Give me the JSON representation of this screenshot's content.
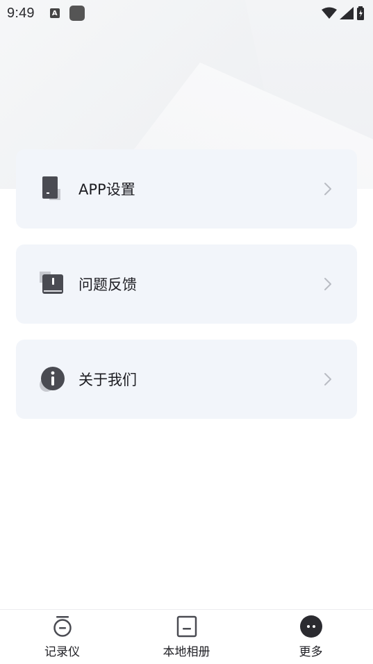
{
  "status_bar": {
    "time": "9:49",
    "notification_badge": "A",
    "icons": [
      "keyboard-icon",
      "app-square-icon",
      "wifi-icon",
      "signal-icon",
      "battery-charging-icon"
    ]
  },
  "menu": {
    "items": [
      {
        "label": "APP设置",
        "icon": "app-settings-icon",
        "chevron": "chevron-right-icon"
      },
      {
        "label": "问题反馈",
        "icon": "feedback-icon",
        "chevron": "chevron-right-icon"
      },
      {
        "label": "关于我们",
        "icon": "info-icon",
        "chevron": "chevron-right-icon"
      }
    ]
  },
  "bottom_nav": {
    "items": [
      {
        "label": "记录仪",
        "icon": "recorder-icon",
        "active": false
      },
      {
        "label": "本地相册",
        "icon": "album-icon",
        "active": false
      },
      {
        "label": "更多",
        "icon": "more-icon",
        "active": true
      }
    ]
  },
  "colors": {
    "card_background": "#f2f5fa",
    "icon_dark": "#4a4b52",
    "icon_shadow": "#c7c9cf",
    "chevron": "#b9bcc3",
    "text": "#1c1c21"
  }
}
